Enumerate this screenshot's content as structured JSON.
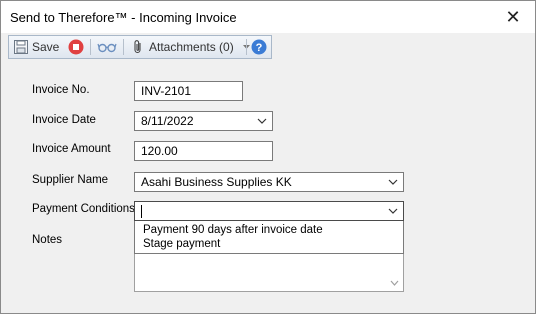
{
  "window": {
    "title": "Send to Therefore™ - Incoming Invoice",
    "close_icon": "✕"
  },
  "toolbar": {
    "save_label": "Save",
    "attachments_label": "Attachments (0)",
    "icons": [
      "save-icon",
      "stop-icon",
      "glasses-icon",
      "paperclip-icon",
      "dropdown-arrow-icon",
      "help-icon"
    ]
  },
  "form": {
    "invoice_no": {
      "label": "Invoice No.",
      "value": "INV-2101"
    },
    "invoice_date": {
      "label": "Invoice Date",
      "value": "8/11/2022"
    },
    "invoice_amount": {
      "label": "Invoice Amount",
      "value": "120.00"
    },
    "supplier_name": {
      "label": "Supplier Name",
      "value": "Asahi Business Supplies KK"
    },
    "payment_conditions": {
      "label": "Payment Conditions",
      "value": "",
      "options": [
        "Payment 90 days after invoice date",
        "Stage payment"
      ]
    },
    "notes": {
      "label": "Notes",
      "value": ""
    }
  },
  "colors": {
    "help_blue": "#3a7bd5",
    "stop_red": "#e04040",
    "toolbar_border": "#a9b8c9"
  }
}
